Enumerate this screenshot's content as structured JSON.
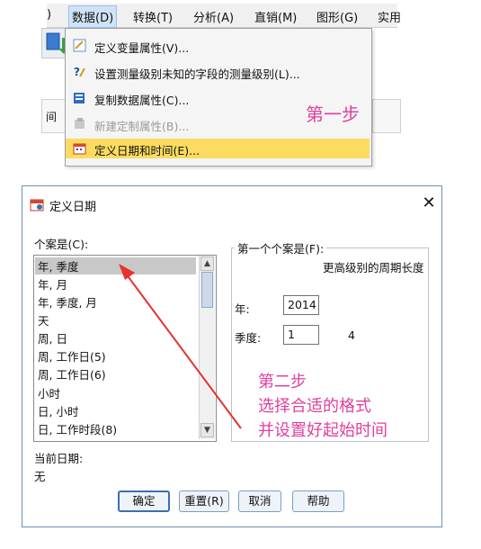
{
  "menubar": {
    "items": [
      {
        "label": ")"
      },
      {
        "label": "数据(D)"
      },
      {
        "label": "转换(T)"
      },
      {
        "label": "分析(A)"
      },
      {
        "label": "直销(M)"
      },
      {
        "label": "图形(G)"
      },
      {
        "label": "实用"
      }
    ]
  },
  "column_header_left": "间",
  "data_menu": {
    "items": [
      {
        "label": "定义变量属性(V)...",
        "icon": "define-variable-properties-icon"
      },
      {
        "label": "设置测量级别未知的字段的测量级别(L)...",
        "icon": "measure-level-icon"
      },
      {
        "label": "复制数据属性(C)...",
        "icon": "copy-data-properties-icon"
      },
      {
        "label": "新建定制属性(B)...",
        "icon": "new-custom-attribute-icon",
        "disabled": true
      },
      {
        "label": "定义日期和时间(E)...",
        "icon": "define-dates-icon",
        "highlighted": true
      }
    ]
  },
  "annotations": {
    "step1": "第一步",
    "step2": [
      "第二步",
      "选择合适的格式",
      "并设置好起始时间"
    ],
    "color": "#e0409c"
  },
  "dialog": {
    "title": "定义日期",
    "close_glyph": "✕",
    "cases_label": "个案是(C):",
    "cases_list": [
      "年, 季度",
      "年, 月",
      "年, 季度, 月",
      "天",
      "周, 日",
      "周, 工作日(5)",
      "周, 工作日(6)",
      "小时",
      "日, 小时",
      "日, 工作时段(8)"
    ],
    "selected_index": 0,
    "first_case_group": "第一个个案是(F):",
    "higher_level_label": "更高级别的周期长度",
    "year_label": "年:",
    "year_value": "2014",
    "quarter_label": "季度:",
    "quarter_value": "1",
    "quarter_period": "4",
    "current_date_label": "当前日期:",
    "current_date_value": "无",
    "buttons": {
      "ok": "确定",
      "reset": "重置(R)",
      "cancel": "取消",
      "help": "帮助"
    }
  },
  "colors": {
    "highlight_yellow": "#fbdc60",
    "arrow_red": "#e8322e",
    "dialog_border": "#6b8fb8"
  }
}
